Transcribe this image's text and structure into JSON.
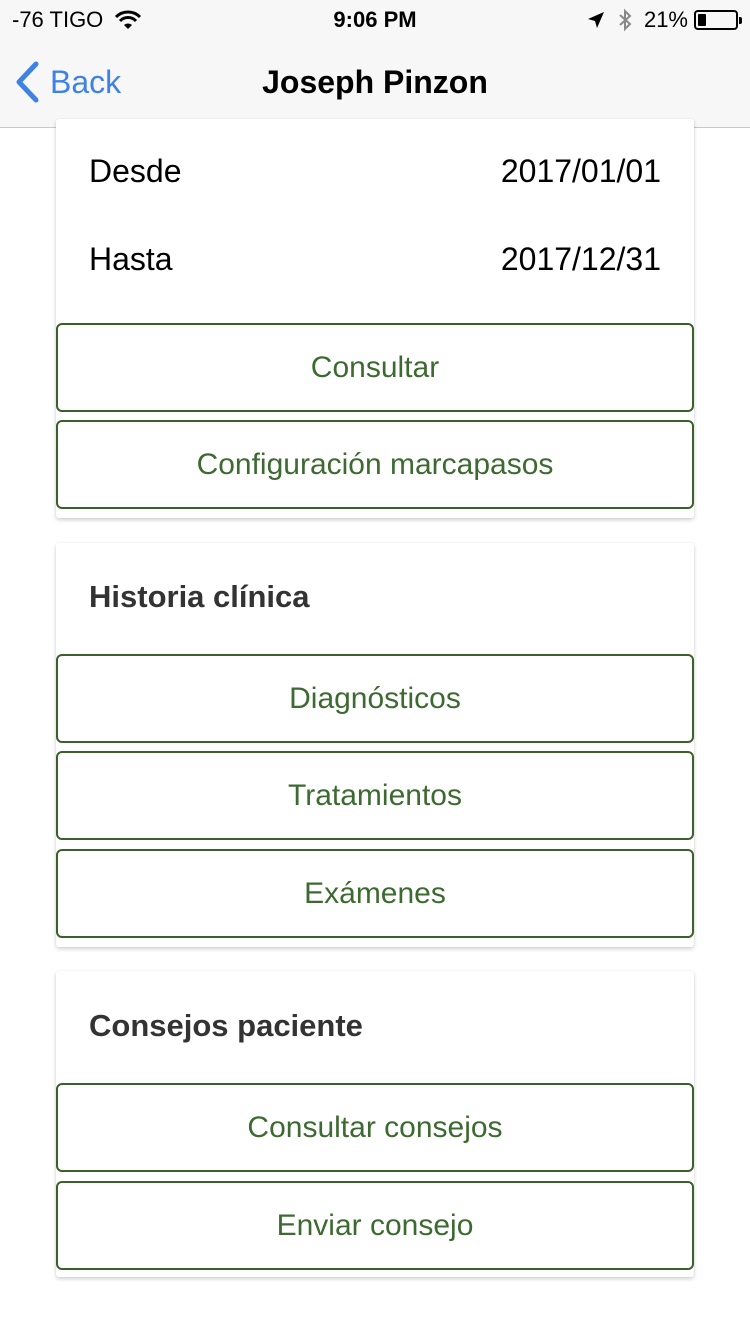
{
  "status_bar": {
    "carrier": "-76 TIGO",
    "time": "9:06 PM",
    "battery_percent": "21%",
    "battery_level": 0.21,
    "icons": [
      "wifi-icon",
      "location-arrow-icon",
      "bluetooth-icon",
      "battery-icon"
    ]
  },
  "nav": {
    "back_label": "Back",
    "title": "Joseph Pinzon",
    "accent": "#3f82e6"
  },
  "period": {
    "from_label": "Desde",
    "from_value": "2017/01/01",
    "to_label": "Hasta",
    "to_value": "2017/12/31",
    "consult_button": "Consultar",
    "pacemaker_button": "Configuración marcapasos"
  },
  "clinical_history": {
    "title": "Historia clínica",
    "buttons": [
      "Diagnósticos",
      "Tratamientos",
      "Exámenes"
    ]
  },
  "patient_advice": {
    "title": "Consejos paciente",
    "buttons": [
      "Consultar consejos",
      "Enviar consejo"
    ]
  },
  "colors": {
    "button_text": "#3d6a31",
    "button_border": "#3c5f2c"
  }
}
